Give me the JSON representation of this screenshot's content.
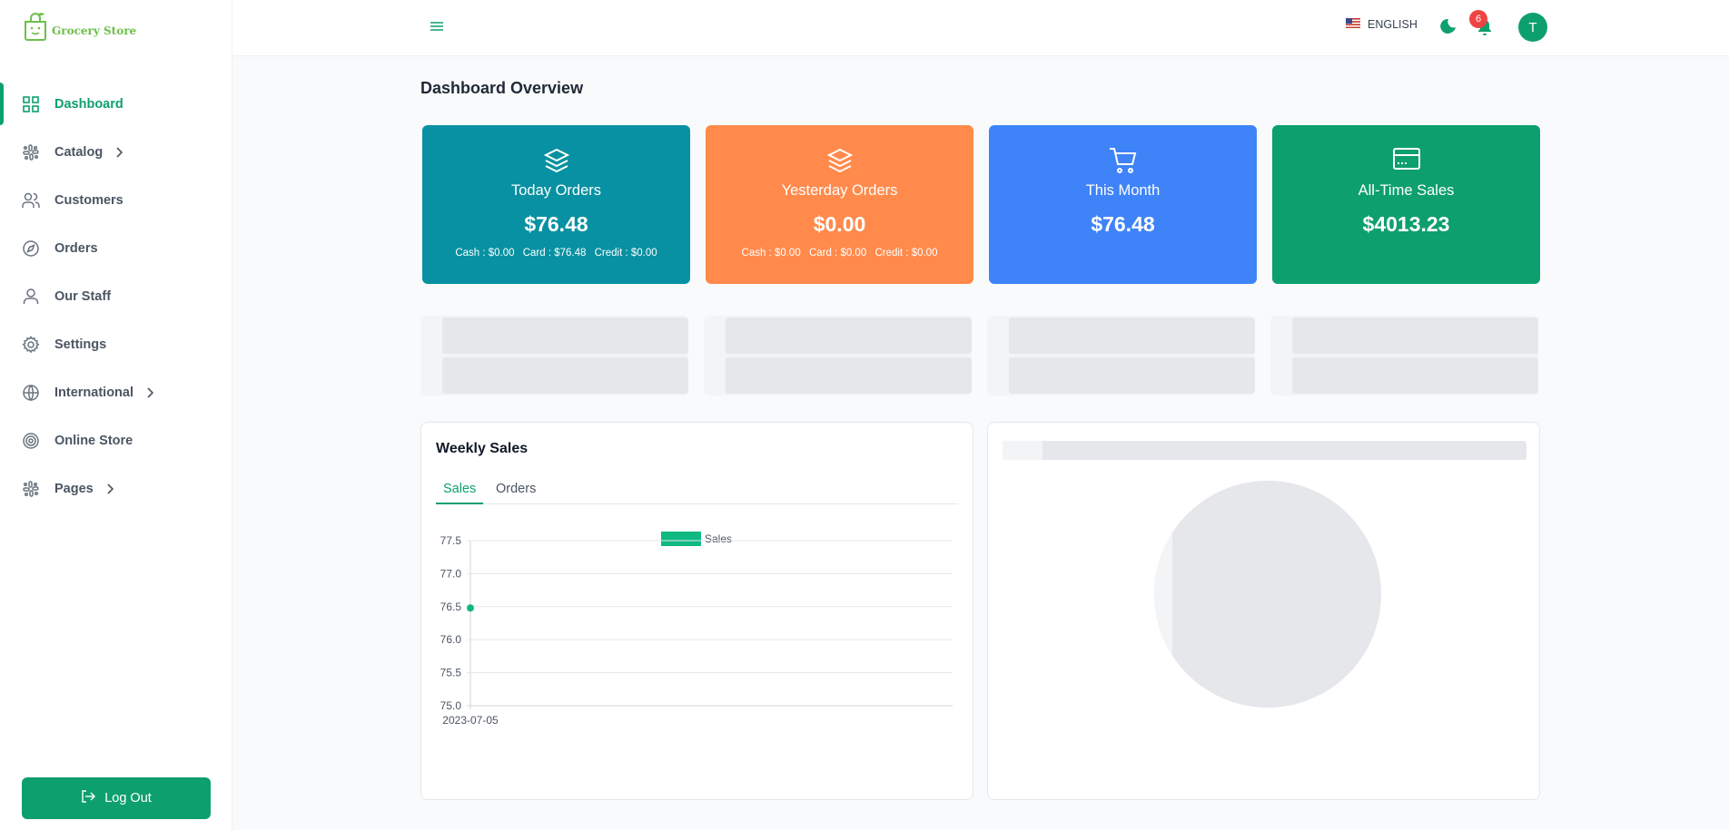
{
  "app": {
    "logo_text": "Grocery Store"
  },
  "sidebar": {
    "items": [
      {
        "label": "Dashboard"
      },
      {
        "label": "Catalog"
      },
      {
        "label": "Customers"
      },
      {
        "label": "Orders"
      },
      {
        "label": "Our Staff"
      },
      {
        "label": "Settings"
      },
      {
        "label": "International"
      },
      {
        "label": "Online Store"
      },
      {
        "label": "Pages"
      }
    ],
    "logout_label": "Log Out"
  },
  "header": {
    "language": "ENGLISH",
    "notification_count": "6",
    "avatar_initial": "T"
  },
  "main": {
    "title": "Dashboard Overview",
    "cards": [
      {
        "title": "Today Orders",
        "value": "$76.48",
        "cash": "Cash : $0.00",
        "card": "Card : $76.48",
        "credit": "Credit : $0.00",
        "color": "#0891a2"
      },
      {
        "title": "Yesterday Orders",
        "value": "$0.00",
        "cash": "Cash : $0.00",
        "card": "Card : $0.00",
        "credit": "Credit : $0.00",
        "color": "#ff8a4c"
      },
      {
        "title": "This Month",
        "value": "$76.48",
        "color": "#3f83f8"
      },
      {
        "title": "All-Time Sales",
        "value": "$4013.23",
        "color": "#0e9f6e"
      }
    ],
    "weekly_sales": {
      "title": "Weekly Sales",
      "tabs": [
        {
          "label": "Sales"
        },
        {
          "label": "Orders"
        }
      ]
    }
  },
  "chart_data": {
    "type": "line",
    "x": [
      "2023-07-05"
    ],
    "series": [
      {
        "name": "Sales",
        "values": [
          76.48
        ],
        "color": "#10b981"
      }
    ],
    "ylim": [
      75.0,
      77.5
    ],
    "yticks": [
      "77.5",
      "77.0",
      "76.5",
      "76.0",
      "75.5",
      "75.0"
    ],
    "legend": "top",
    "grid": true
  }
}
